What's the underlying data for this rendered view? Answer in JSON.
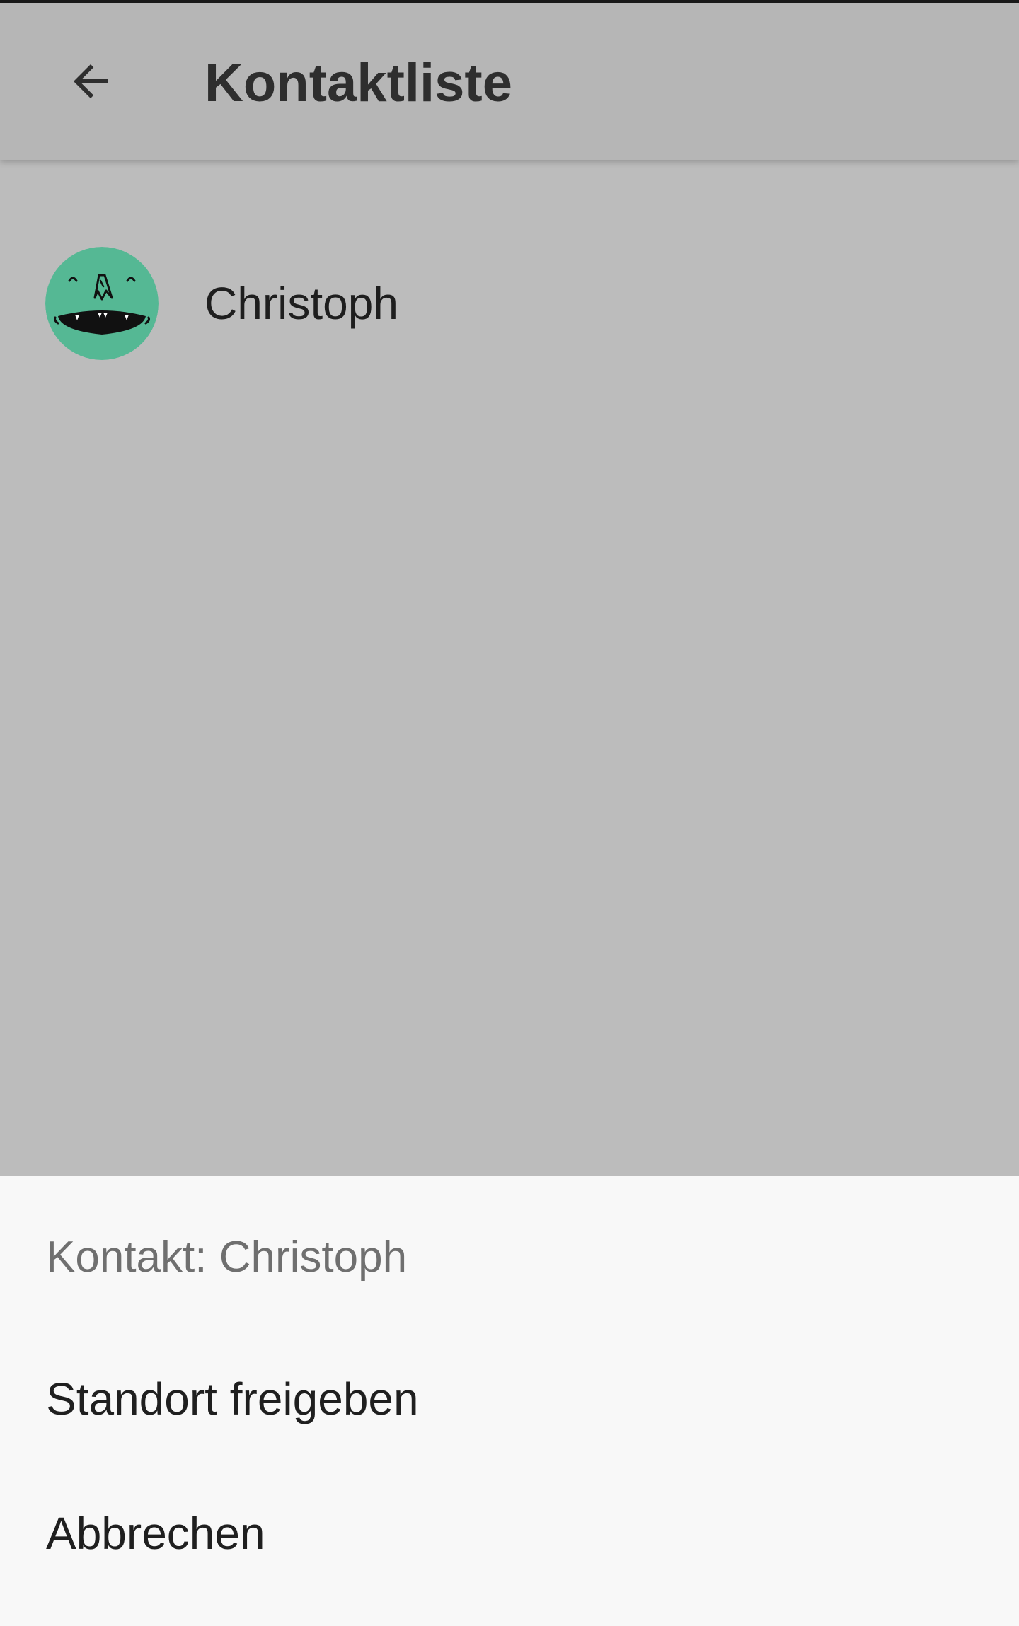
{
  "toolbar": {
    "title": "Kontaktliste",
    "back_icon": "arrow-left-icon"
  },
  "contacts": [
    {
      "name": "Christoph",
      "avatar_icon": "monster-face-avatar",
      "avatar_color": "#55b894"
    }
  ],
  "sheet": {
    "title": "Kontakt: Christoph",
    "items": [
      {
        "label": "Standort freigeben"
      },
      {
        "label": "Abbrechen"
      }
    ]
  },
  "colors": {
    "toolbar_bg": "#b6b6b6",
    "scrim_bg": "#bcbcbc",
    "sheet_bg": "#f8f8f8",
    "text_primary": "#1e1e1e",
    "text_secondary": "#6f6f6f"
  }
}
